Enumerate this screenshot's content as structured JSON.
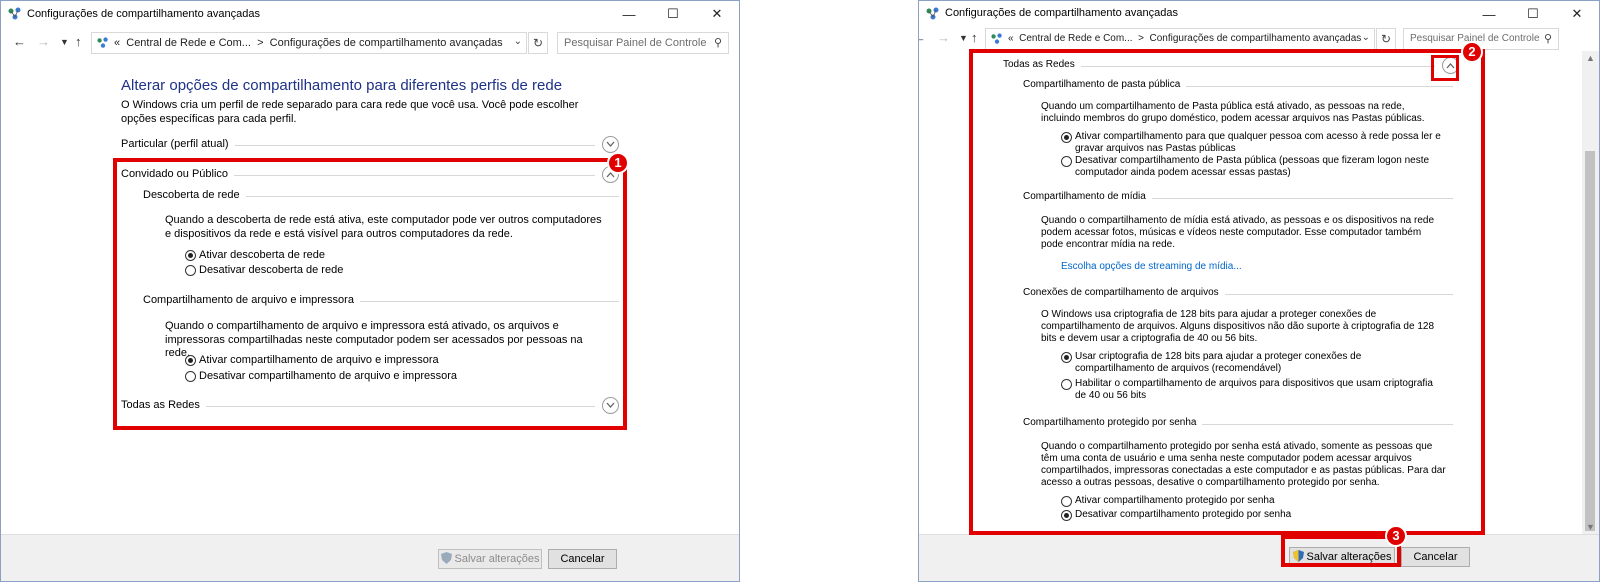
{
  "colors": {
    "accent_heading": "#1e3287",
    "link": "#0066cc",
    "highlight": "#e00000"
  },
  "window1": {
    "title": "Configurações de compartilhamento avançadas",
    "title_icon": "network-center-icon",
    "nav": {
      "back_icon": "back-arrow-icon",
      "forward_icon": "forward-arrow-icon",
      "recent_icon": "chevron-down-icon",
      "up_icon": "up-arrow-icon"
    },
    "address": {
      "prefix": "«",
      "crumb1": "Central de Rede e Com...",
      "sep": ">",
      "crumb2": "Configurações de compartilhamento avançadas"
    },
    "search_placeholder": "Pesquisar Painel de Controle",
    "heading": "Alterar opções de compartilhamento para diferentes perfis de rede",
    "description": "O Windows cria um perfil de rede separado para cara rede que você usa. Você pode escolher opções específicas para cada perfil.",
    "profile_private": "Particular (perfil atual)",
    "profile_guest": "Convidado ou Público",
    "discovery": {
      "title": "Descoberta de rede",
      "text": "Quando a descoberta de rede está ativa, este computador pode ver outros computadores e dispositivos da rede e está visível para outros computadores da rede.",
      "option_on": "Ativar descoberta de rede",
      "option_off": "Desativar descoberta de rede",
      "selected": "on"
    },
    "file_sharing": {
      "title": "Compartilhamento de arquivo e impressora",
      "text": "Quando o compartilhamento de arquivo e impressora está ativado, os arquivos e impressoras compartilhadas neste computador podem ser acessados por pessoas na rede.",
      "option_on": "Ativar compartilhamento de arquivo e impressora",
      "option_off": "Desativar compartilhamento de arquivo e impressora",
      "selected": "on"
    },
    "all_networks": "Todas as Redes",
    "save_label": "Salvar alterações",
    "cancel_label": "Cancelar",
    "badge": "1"
  },
  "window2": {
    "title": "Configurações de compartilhamento avançadas",
    "address": {
      "prefix": "«",
      "crumb1": "Central de Rede e Com...",
      "sep": ">",
      "crumb2": "Configurações de compartilhamento avançadas"
    },
    "search_placeholder": "Pesquisar Painel de Controle",
    "all_networks": "Todas as Redes",
    "public_folder": {
      "title": "Compartilhamento de pasta pública",
      "text": "Quando um compartilhamento de Pasta pública está ativado, as pessoas na rede, incluindo membros do grupo doméstico, podem acessar arquivos nas Pastas públicas.",
      "option_on": "Ativar compartilhamento para que qualquer pessoa com acesso à rede possa ler e gravar arquivos nas Pastas públicas",
      "option_off": "Desativar compartilhamento de Pasta pública (pessoas que fizeram logon neste computador ainda podem acessar essas pastas)",
      "selected": "on"
    },
    "media": {
      "title": "Compartilhamento de mídia",
      "text": "Quando o compartilhamento de mídia está ativado, as pessoas e os dispositivos na rede podem acessar fotos, músicas e vídeos neste computador. Esse computador também pode encontrar mídia na rede.",
      "link": "Escolha opções de streaming de mídia..."
    },
    "connections": {
      "title": "Conexões de compartilhamento de arquivos",
      "text": "O Windows usa criptografia de 128 bits para ajudar a proteger conexões de compartilhamento de arquivos. Alguns dispositivos não dão suporte à criptografia de 128 bits e devem usar a criptografia de 40 ou 56 bits.",
      "option_128": "Usar criptografia de 128 bits para ajudar a proteger conexões de compartilhamento de arquivos (recomendável)",
      "option_40": "Habilitar o compartilhamento de arquivos para dispositivos que usam criptografia de 40 ou 56 bits",
      "selected": "128"
    },
    "password": {
      "title": "Compartilhamento protegido por senha",
      "text": "Quando o compartilhamento protegido por senha está ativado, somente as pessoas que têm uma conta de usuário e uma senha neste computador podem acessar arquivos compartilhados, impressoras conectadas a este computador e as pastas públicas. Para dar acesso a outras pessoas, desative o compartilhamento protegido por senha.",
      "option_on": "Ativar compartilhamento protegido por senha",
      "option_off": "Desativar compartilhamento protegido por senha",
      "selected": "off"
    },
    "save_label": "Salvar alterações",
    "cancel_label": "Cancelar",
    "badge_collapse": "2",
    "badge_save": "3"
  }
}
